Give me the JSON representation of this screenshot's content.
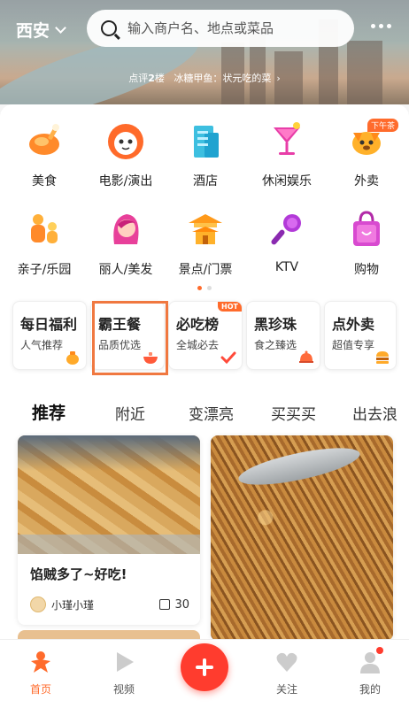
{
  "header": {
    "city": "西安",
    "search_placeholder": "输入商户名、地点或菜品",
    "promo_brand": "点评",
    "promo_num": "2",
    "promo_suffix": "楼",
    "promo_text": "冰糖甲鱼：状元吃的菜"
  },
  "categories": [
    {
      "label": "美食",
      "icon": "roast-chicken-icon"
    },
    {
      "label": "电影/演出",
      "icon": "cat-face-icon"
    },
    {
      "label": "酒店",
      "icon": "hotel-building-icon"
    },
    {
      "label": "休闲娱乐",
      "icon": "cocktail-icon"
    },
    {
      "label": "外卖",
      "icon": "delivery-dog-icon",
      "badge": "下午茶"
    },
    {
      "label": "亲子/乐园",
      "icon": "family-icon"
    },
    {
      "label": "丽人/美发",
      "icon": "woman-hair-icon"
    },
    {
      "label": "景点/门票",
      "icon": "pagoda-icon"
    },
    {
      "label": "KTV",
      "icon": "microphone-icon"
    },
    {
      "label": "购物",
      "icon": "shopping-bag-icon"
    }
  ],
  "promo_cards": [
    {
      "title": "每日福利",
      "subtitle": "人气推荐",
      "icon": "money-bag-icon"
    },
    {
      "title": "霸王餐",
      "subtitle": "品质优选",
      "icon": "hotpot-icon"
    },
    {
      "title": "必吃榜",
      "subtitle": "全城必去",
      "icon": "checkmark-icon",
      "badge": "HOT"
    },
    {
      "title": "黑珍珠",
      "subtitle": "食之臻选",
      "icon": "cloche-icon"
    },
    {
      "title": "点外卖",
      "subtitle": "超值专享",
      "icon": "burger-icon"
    }
  ],
  "feed_tabs": [
    "推荐",
    "附近",
    "变漂亮",
    "买买买",
    "出去浪"
  ],
  "feed": {
    "card1": {
      "title": "馅贼多了~好吃!",
      "author": "小瑾小瑾",
      "likes": "30"
    }
  },
  "nav": [
    "首页",
    "视频",
    "关注",
    "我的"
  ],
  "colors": {
    "accent": "#ff6b2c",
    "fab": "#ff3c2e"
  }
}
